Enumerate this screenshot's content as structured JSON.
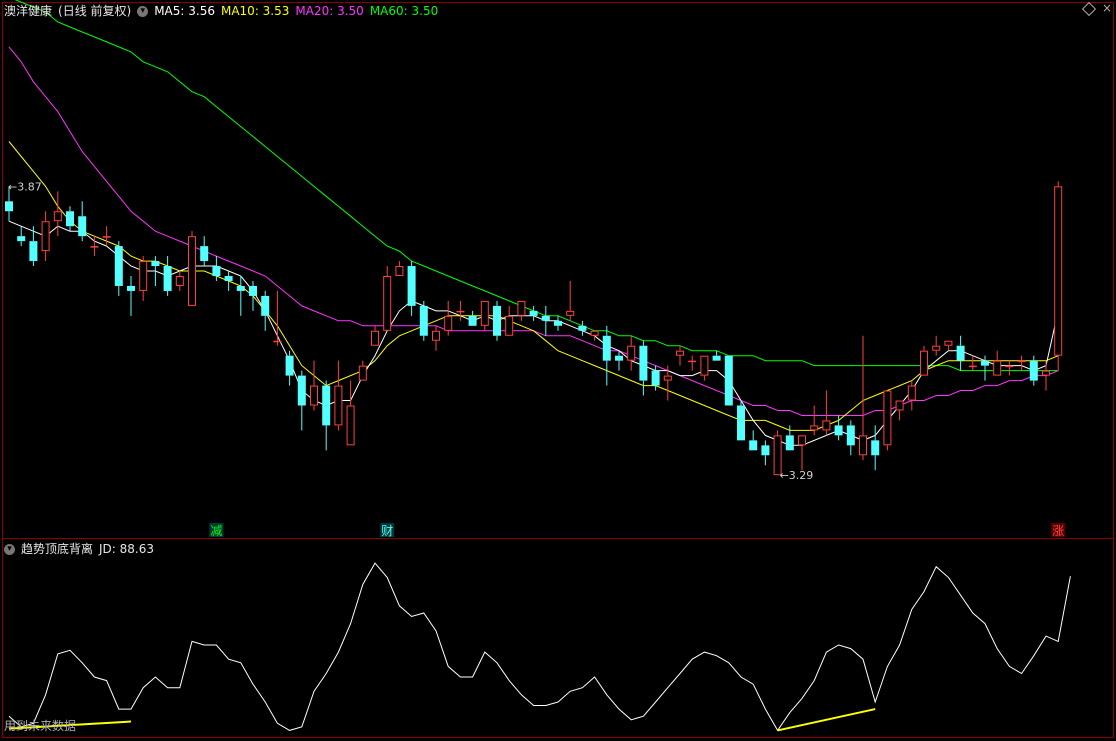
{
  "main_header": {
    "stock_name": "澳洋健康",
    "period": "(日线 前复权)",
    "ma5_label": "MA5: 3.56",
    "ma10_label": "MA10: 3.53",
    "ma20_label": "MA20: 3.50",
    "ma60_label": "MA60: 3.50"
  },
  "indicator_header": {
    "name": "趋势顶底背离",
    "jd_label": "JD: 88.63"
  },
  "footer_note": "用到未来数据",
  "window_buttons": {
    "close": "×"
  },
  "colors": {
    "background": "#000000",
    "up": "#ff4040",
    "down": "#54ffff",
    "ma5": "#ffffff",
    "ma10": "#ffff00",
    "ma20": "#ff33ff",
    "ma60": "#00ff00",
    "divergence": "#ffff00",
    "frame": "#8a0000"
  },
  "chart_data": [
    {
      "type": "candlestick",
      "title": "澳洋健康 (日线 前复权)",
      "ylim": [
        3.18,
        4.2
      ],
      "annotations": {
        "high_label": "3.87",
        "low_label": "3.29",
        "markers": [
          {
            "text": "减",
            "color": "#00ff00",
            "bar": 17
          },
          {
            "text": "财",
            "color": "#54ffff",
            "bar": 31
          },
          {
            "text": "涨",
            "color": "#ff4040",
            "bar": 86
          }
        ]
      },
      "candles": [
        [
          3.84,
          3.87,
          3.8,
          3.82
        ],
        [
          3.77,
          3.79,
          3.75,
          3.76
        ],
        [
          3.76,
          3.79,
          3.71,
          3.72
        ],
        [
          3.74,
          3.82,
          3.72,
          3.8
        ],
        [
          3.8,
          3.86,
          3.77,
          3.82
        ],
        [
          3.82,
          3.83,
          3.78,
          3.79
        ],
        [
          3.81,
          3.84,
          3.76,
          3.77
        ],
        [
          3.75,
          3.77,
          3.73,
          3.75
        ],
        [
          3.77,
          3.79,
          3.75,
          3.77
        ],
        [
          3.75,
          3.76,
          3.65,
          3.67
        ],
        [
          3.67,
          3.69,
          3.61,
          3.66
        ],
        [
          3.66,
          3.73,
          3.64,
          3.72
        ],
        [
          3.72,
          3.73,
          3.67,
          3.71
        ],
        [
          3.71,
          3.73,
          3.65,
          3.66
        ],
        [
          3.67,
          3.7,
          3.66,
          3.69
        ],
        [
          3.63,
          3.78,
          3.63,
          3.77
        ],
        [
          3.75,
          3.77,
          3.71,
          3.72
        ],
        [
          3.71,
          3.73,
          3.68,
          3.69
        ],
        [
          3.69,
          3.7,
          3.66,
          3.68
        ],
        [
          3.67,
          3.69,
          3.61,
          3.66
        ],
        [
          3.67,
          3.68,
          3.62,
          3.65
        ],
        [
          3.65,
          3.66,
          3.58,
          3.61
        ],
        [
          3.56,
          3.66,
          3.55,
          3.56
        ],
        [
          3.53,
          3.54,
          3.47,
          3.49
        ],
        [
          3.49,
          3.5,
          3.38,
          3.43
        ],
        [
          3.43,
          3.52,
          3.42,
          3.47
        ],
        [
          3.47,
          3.48,
          3.34,
          3.39
        ],
        [
          3.39,
          3.52,
          3.38,
          3.47
        ],
        [
          3.35,
          3.48,
          3.35,
          3.43
        ],
        [
          3.48,
          3.52,
          3.48,
          3.51
        ],
        [
          3.55,
          3.59,
          3.55,
          3.58
        ],
        [
          3.58,
          3.71,
          3.58,
          3.69
        ],
        [
          3.69,
          3.72,
          3.69,
          3.71
        ],
        [
          3.71,
          3.72,
          3.61,
          3.63
        ],
        [
          3.63,
          3.64,
          3.56,
          3.57
        ],
        [
          3.56,
          3.59,
          3.54,
          3.58
        ],
        [
          3.58,
          3.64,
          3.57,
          3.61
        ],
        [
          3.62,
          3.64,
          3.6,
          3.62
        ],
        [
          3.61,
          3.62,
          3.59,
          3.59
        ],
        [
          3.59,
          3.63,
          3.58,
          3.64
        ],
        [
          3.63,
          3.64,
          3.56,
          3.57
        ],
        [
          3.57,
          3.63,
          3.57,
          3.61
        ],
        [
          3.61,
          3.64,
          3.6,
          3.64
        ],
        [
          3.62,
          3.63,
          3.6,
          3.61
        ],
        [
          3.61,
          3.63,
          3.57,
          3.6
        ],
        [
          3.6,
          3.61,
          3.58,
          3.59
        ],
        [
          3.61,
          3.68,
          3.6,
          3.62
        ],
        [
          3.59,
          3.6,
          3.57,
          3.58
        ],
        [
          3.57,
          3.58,
          3.56,
          3.58
        ],
        [
          3.57,
          3.59,
          3.47,
          3.52
        ],
        [
          3.53,
          3.54,
          3.5,
          3.52
        ],
        [
          3.52,
          3.57,
          3.5,
          3.55
        ],
        [
          3.55,
          3.56,
          3.45,
          3.48
        ],
        [
          3.5,
          3.51,
          3.46,
          3.47
        ],
        [
          3.48,
          3.51,
          3.44,
          3.49
        ],
        [
          3.53,
          3.55,
          3.51,
          3.54
        ],
        [
          3.52,
          3.53,
          3.5,
          3.52
        ],
        [
          3.49,
          3.53,
          3.48,
          3.53
        ],
        [
          3.53,
          3.54,
          3.52,
          3.52
        ],
        [
          3.53,
          3.53,
          3.48,
          3.43
        ],
        [
          3.43,
          3.44,
          3.36,
          3.36
        ],
        [
          3.36,
          3.38,
          3.34,
          3.34
        ],
        [
          3.35,
          3.36,
          3.31,
          3.33
        ],
        [
          3.29,
          3.38,
          3.29,
          3.37
        ],
        [
          3.37,
          3.39,
          3.34,
          3.34
        ],
        [
          3.35,
          3.37,
          3.3,
          3.37
        ],
        [
          3.38,
          3.43,
          3.37,
          3.39
        ],
        [
          3.38,
          3.46,
          3.37,
          3.4
        ],
        [
          3.39,
          3.41,
          3.36,
          3.37
        ],
        [
          3.39,
          3.4,
          3.33,
          3.35
        ],
        [
          3.33,
          3.57,
          3.32,
          3.37
        ],
        [
          3.36,
          3.39,
          3.3,
          3.33
        ],
        [
          3.35,
          3.44,
          3.34,
          3.46
        ],
        [
          3.42,
          3.44,
          3.4,
          3.44
        ],
        [
          3.44,
          3.48,
          3.42,
          3.47
        ],
        [
          3.49,
          3.55,
          3.49,
          3.54
        ],
        [
          3.54,
          3.57,
          3.53,
          3.55
        ],
        [
          3.55,
          3.56,
          3.54,
          3.56
        ],
        [
          3.55,
          3.57,
          3.5,
          3.52
        ],
        [
          3.51,
          3.53,
          3.5,
          3.51
        ],
        [
          3.52,
          3.53,
          3.48,
          3.51
        ],
        [
          3.49,
          3.54,
          3.49,
          3.52
        ],
        [
          3.51,
          3.52,
          3.49,
          3.51
        ],
        [
          3.52,
          3.53,
          3.5,
          3.52
        ],
        [
          3.52,
          3.53,
          3.47,
          3.48
        ],
        [
          3.49,
          3.52,
          3.46,
          3.5
        ],
        [
          3.53,
          3.88,
          3.5,
          3.87
        ]
      ],
      "ma5": [
        3.8,
        3.79,
        3.78,
        3.77,
        3.79,
        3.78,
        3.78,
        3.76,
        3.75,
        3.73,
        3.71,
        3.7,
        3.7,
        3.69,
        3.7,
        3.71,
        3.71,
        3.71,
        3.7,
        3.69,
        3.66,
        3.62,
        3.57,
        3.52,
        3.46,
        3.44,
        3.43,
        3.44,
        3.44,
        3.49,
        3.53,
        3.58,
        3.62,
        3.64,
        3.63,
        3.62,
        3.62,
        3.61,
        3.6,
        3.61,
        3.6,
        3.61,
        3.61,
        3.61,
        3.6,
        3.6,
        3.59,
        3.58,
        3.57,
        3.55,
        3.54,
        3.52,
        3.51,
        3.5,
        3.5,
        3.49,
        3.49,
        3.5,
        3.5,
        3.48,
        3.44,
        3.4,
        3.37,
        3.36,
        3.35,
        3.35,
        3.36,
        3.37,
        3.38,
        3.37,
        3.36,
        3.37,
        3.4,
        3.43,
        3.46,
        3.5,
        3.52,
        3.54,
        3.54,
        3.53,
        3.52,
        3.51,
        3.51,
        3.51,
        3.5,
        3.51,
        3.62
      ],
      "ma10": [
        3.96,
        3.93,
        3.9,
        3.87,
        3.83,
        3.8,
        3.78,
        3.77,
        3.76,
        3.75,
        3.73,
        3.72,
        3.72,
        3.71,
        3.7,
        3.7,
        3.7,
        3.69,
        3.68,
        3.67,
        3.65,
        3.62,
        3.59,
        3.55,
        3.51,
        3.49,
        3.47,
        3.48,
        3.49,
        3.5,
        3.52,
        3.55,
        3.57,
        3.58,
        3.59,
        3.6,
        3.61,
        3.61,
        3.61,
        3.61,
        3.61,
        3.6,
        3.59,
        3.58,
        3.56,
        3.54,
        3.53,
        3.52,
        3.51,
        3.5,
        3.49,
        3.48,
        3.47,
        3.47,
        3.46,
        3.45,
        3.44,
        3.43,
        3.42,
        3.41,
        3.4,
        3.4,
        3.4,
        3.39,
        3.38,
        3.38,
        3.38,
        3.39,
        3.4,
        3.42,
        3.44,
        3.45,
        3.46,
        3.47,
        3.48,
        3.5,
        3.51,
        3.52,
        3.52,
        3.52,
        3.52,
        3.52,
        3.52,
        3.52,
        3.52,
        3.52,
        3.53
      ],
      "ma20": [
        4.15,
        4.12,
        4.08,
        4.05,
        4.02,
        3.98,
        3.94,
        3.91,
        3.88,
        3.85,
        3.82,
        3.8,
        3.78,
        3.77,
        3.76,
        3.75,
        3.74,
        3.73,
        3.72,
        3.71,
        3.7,
        3.69,
        3.67,
        3.65,
        3.63,
        3.62,
        3.61,
        3.6,
        3.6,
        3.59,
        3.59,
        3.59,
        3.59,
        3.59,
        3.59,
        3.59,
        3.58,
        3.58,
        3.58,
        3.58,
        3.58,
        3.58,
        3.58,
        3.58,
        3.57,
        3.57,
        3.57,
        3.56,
        3.55,
        3.54,
        3.54,
        3.53,
        3.52,
        3.51,
        3.5,
        3.49,
        3.48,
        3.47,
        3.46,
        3.45,
        3.44,
        3.43,
        3.43,
        3.42,
        3.42,
        3.41,
        3.41,
        3.41,
        3.41,
        3.41,
        3.41,
        3.42,
        3.42,
        3.43,
        3.44,
        3.44,
        3.45,
        3.45,
        3.46,
        3.46,
        3.47,
        3.47,
        3.48,
        3.48,
        3.49,
        3.49,
        3.5
      ],
      "ma60": [
        4.25,
        4.24,
        4.23,
        4.22,
        4.2,
        4.19,
        4.18,
        4.17,
        4.16,
        4.15,
        4.14,
        4.12,
        4.11,
        4.1,
        4.08,
        4.06,
        4.05,
        4.03,
        4.01,
        3.99,
        3.97,
        3.95,
        3.93,
        3.91,
        3.89,
        3.87,
        3.85,
        3.83,
        3.81,
        3.79,
        3.77,
        3.75,
        3.74,
        3.72,
        3.71,
        3.7,
        3.69,
        3.68,
        3.67,
        3.66,
        3.65,
        3.64,
        3.63,
        3.62,
        3.61,
        3.61,
        3.6,
        3.59,
        3.58,
        3.58,
        3.57,
        3.57,
        3.56,
        3.56,
        3.55,
        3.55,
        3.54,
        3.54,
        3.54,
        3.53,
        3.53,
        3.53,
        3.52,
        3.52,
        3.52,
        3.52,
        3.51,
        3.51,
        3.51,
        3.51,
        3.51,
        3.51,
        3.51,
        3.51,
        3.51,
        3.51,
        3.51,
        3.51,
        3.5,
        3.5,
        3.5,
        3.5,
        3.5,
        3.5,
        3.5,
        3.5,
        3.5
      ]
    },
    {
      "type": "line",
      "title": "趋势顶底背离",
      "ylim": [
        0,
        100
      ],
      "series": [
        {
          "name": "JD",
          "values": [
            10,
            4,
            6,
            22,
            45,
            47,
            40,
            32,
            30,
            14,
            14,
            26,
            32,
            26,
            26,
            52,
            50,
            50,
            42,
            40,
            28,
            18,
            6,
            2,
            4,
            24,
            34,
            46,
            62,
            84,
            96,
            88,
            72,
            66,
            68,
            58,
            38,
            32,
            32,
            46,
            40,
            30,
            22,
            16,
            16,
            18,
            24,
            26,
            32,
            22,
            14,
            8,
            10,
            18,
            26,
            34,
            42,
            46,
            44,
            40,
            32,
            28,
            14,
            2,
            12,
            20,
            30,
            46,
            50,
            48,
            42,
            18,
            38,
            50,
            70,
            80,
            94,
            88,
            78,
            68,
            62,
            48,
            38,
            34,
            44,
            55,
            52,
            88.63
          ]
        }
      ],
      "divergence_segments": [
        {
          "from": 0,
          "to": 10,
          "values": [
            3,
            7
          ]
        },
        {
          "from": 63,
          "to": 71,
          "values": [
            2,
            14
          ]
        }
      ]
    }
  ]
}
